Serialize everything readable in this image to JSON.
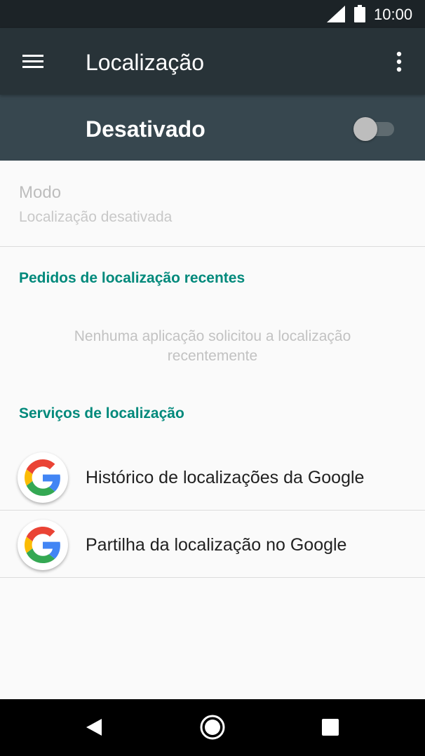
{
  "status_bar": {
    "time": "10:00",
    "icons": [
      "signal-icon",
      "battery-icon"
    ]
  },
  "app_bar": {
    "title": "Localização",
    "icons": [
      "menu-icon",
      "more-vert-icon"
    ]
  },
  "master_switch": {
    "label": "Desativado",
    "state": false
  },
  "mode": {
    "title": "Modo",
    "subtitle": "Localização desativada"
  },
  "recent_requests": {
    "header": "Pedidos de localização recentes",
    "empty_line1": "Nenhuma aplicação solicitou a localização",
    "empty_line2": "recentemente"
  },
  "services": {
    "header": "Serviços de localização",
    "items": [
      {
        "label": "Histórico de localizações da Google",
        "icon": "google-icon"
      },
      {
        "label": "Partilha da localização no Google",
        "icon": "google-icon"
      }
    ]
  },
  "nav_bar": {
    "icons": [
      "back-icon",
      "home-icon",
      "recents-icon"
    ]
  },
  "colors": {
    "status_bar": "#1c2327",
    "app_bar": "#283338",
    "switch_bar": "#37474f",
    "accent": "#00897b",
    "background": "#fafafa"
  }
}
